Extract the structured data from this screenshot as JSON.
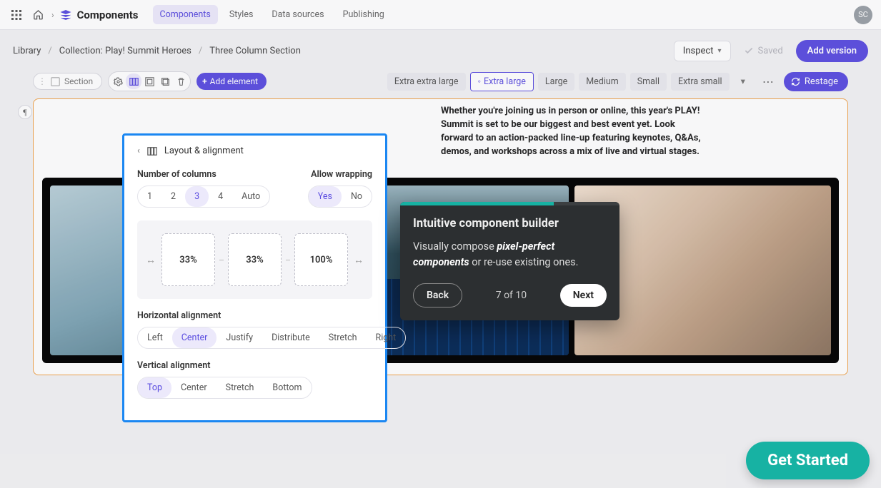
{
  "appbar": {
    "title": "Components",
    "tabs": [
      "Components",
      "Styles",
      "Data sources",
      "Publishing"
    ],
    "active_tab": 0,
    "avatar": "SC"
  },
  "breadcrumbs": [
    "Library",
    "Collection: Play! Summit Heroes",
    "Three Column Section"
  ],
  "subbar": {
    "inspect": "Inspect",
    "saved": "Saved",
    "add_version": "Add version"
  },
  "toolbar": {
    "section_label": "Section",
    "add_element": "Add element",
    "breakpoints": [
      "Extra extra large",
      "Extra large",
      "Large",
      "Medium",
      "Small",
      "Extra small"
    ],
    "selected_bp": 1,
    "restage": "Restage"
  },
  "stage": {
    "paragraph": "Whether you're joining us in person or online, this year's PLAY! Summit is set to be our biggest and best event yet. Look forward to an action-packed line-up featuring keynotes, Q&As, demos, and workshops across a mix of live and virtual stages."
  },
  "layout_panel": {
    "title": "Layout & alignment",
    "num_cols_label": "Number of columns",
    "num_cols_options": [
      "1",
      "2",
      "3",
      "4",
      "Auto"
    ],
    "num_cols_selected": 2,
    "wrap_label": "Allow wrapping",
    "wrap_options": [
      "Yes",
      "No"
    ],
    "wrap_selected": 0,
    "col_widths": [
      "33%",
      "33%",
      "100%"
    ],
    "halign_label": "Horizontal alignment",
    "halign_options": [
      "Left",
      "Center",
      "Justify",
      "Distribute",
      "Stretch",
      "Right"
    ],
    "halign_selected": 1,
    "valign_label": "Vertical alignment",
    "valign_options": [
      "Top",
      "Center",
      "Stretch",
      "Bottom"
    ],
    "valign_selected": 0
  },
  "tour": {
    "title": "Intuitive component builder",
    "text_prefix": "Visually compose ",
    "text_em": "pixel-perfect components",
    "text_suffix": " or re-use existing ones.",
    "back": "Back",
    "next": "Next",
    "count": "7 of 10"
  },
  "get_started": "Get Started"
}
